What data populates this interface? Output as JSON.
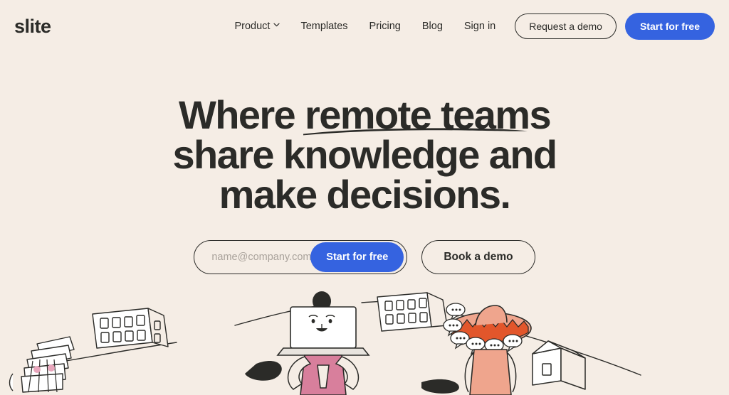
{
  "brand": {
    "logo_text": "slite",
    "accent_blue": "#3563E0",
    "background": "#F5EDE5",
    "ink": "#2B2B28",
    "pink": "#E48FA8",
    "peach": "#F0A88E",
    "orange": "#E2562B"
  },
  "header": {
    "nav": [
      {
        "label": "Product",
        "has_chevron": true,
        "icon": "chevron-down-icon"
      },
      {
        "label": "Templates",
        "has_chevron": false
      },
      {
        "label": "Pricing",
        "has_chevron": false
      },
      {
        "label": "Blog",
        "has_chevron": false
      },
      {
        "label": "Sign in",
        "has_chevron": false
      }
    ],
    "demo_button": "Request a demo",
    "cta_button": "Start for free"
  },
  "hero": {
    "headline_line_1": "Where remote teams",
    "headline_line_2": "share knowledge and",
    "headline_line_3": "make decisions.",
    "underline_note": "hand-drawn brush underline beneath \"remote teams\""
  },
  "cta": {
    "email_placeholder": "name@company.com",
    "email_value": "",
    "input_icon": "slite-mark-icon",
    "submit_label": "Start for free",
    "demo_label": "Book a demo"
  },
  "illustration": {
    "description": "Hand-drawn line illustration of people connected by a curved line",
    "figures": [
      {
        "name": "papers-head-person",
        "detail": "figure with fan of documents as head, pink cheeks"
      },
      {
        "name": "laptop-head-person",
        "detail": "person in pink outfit holding a laptop with a smiling face"
      },
      {
        "name": "sombrero-person",
        "detail": "person in peach shirt wearing sombrero ringed with speech bubbles"
      }
    ],
    "props": [
      {
        "name": "office-building-left"
      },
      {
        "name": "office-building-right"
      },
      {
        "name": "small-house"
      }
    ]
  }
}
